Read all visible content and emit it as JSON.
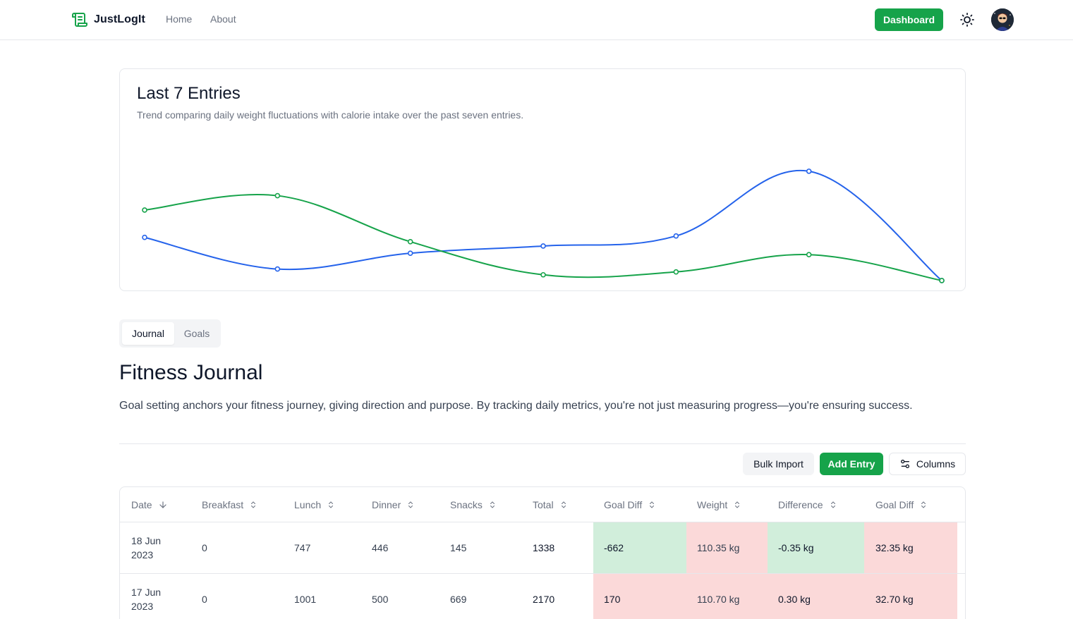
{
  "nav": {
    "brand": "JustLogIt",
    "links": [
      "Home",
      "About"
    ],
    "dashboard": "Dashboard"
  },
  "chart_card": {
    "title": "Last 7 Entries",
    "subtitle": "Trend comparing daily weight fluctuations with calorie intake over the past seven entries."
  },
  "chart_data": {
    "type": "line",
    "x": [
      1,
      2,
      3,
      4,
      5,
      6,
      7
    ],
    "series": [
      {
        "color": "#2563eb",
        "values": [
          0.32,
          0.1,
          0.21,
          0.26,
          0.33,
          0.78,
          0.02
        ]
      },
      {
        "color": "#16a34a",
        "values": [
          0.51,
          0.61,
          0.29,
          0.06,
          0.08,
          0.2,
          0.02
        ]
      }
    ],
    "ylim": [
      0,
      1
    ],
    "grid": false
  },
  "tabs": [
    "Journal",
    "Goals"
  ],
  "journal": {
    "title": "Fitness Journal",
    "description": "Goal setting anchors your fitness journey, giving direction and purpose. By tracking daily metrics, you're not just measuring progress—you're ensuring success."
  },
  "toolbar": {
    "bulk_import": "Bulk Import",
    "add_entry": "Add Entry",
    "columns": "Columns"
  },
  "table": {
    "headers": [
      "Date",
      "Breakfast",
      "Lunch",
      "Dinner",
      "Snacks",
      "Total",
      "Goal Diff",
      "Weight",
      "Difference",
      "Goal Diff"
    ],
    "rows": [
      {
        "date1": "18 Jun",
        "date2": "2023",
        "breakfast": "0",
        "lunch": "747",
        "dinner": "446",
        "snacks": "145",
        "total": "1338",
        "goal_diff": "-662",
        "weight": "110.35 kg",
        "difference": "-0.35 kg",
        "weight_goal_diff": "32.35 kg"
      },
      {
        "date1": "17 Jun",
        "date2": "2023",
        "breakfast": "0",
        "lunch": "1001",
        "dinner": "500",
        "snacks": "669",
        "total": "2170",
        "goal_diff": "170",
        "weight": "110.70 kg",
        "difference": "0.30 kg",
        "weight_goal_diff": "32.70 kg"
      }
    ]
  }
}
